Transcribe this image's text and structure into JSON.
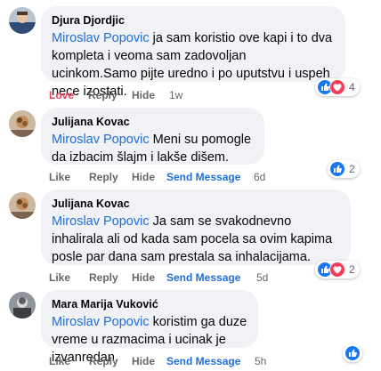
{
  "comments": [
    {
      "author": "Djura Djordjic",
      "mention": "Miroslav Popovic",
      "text": " ja sam koristio ove kapi i to dva kompleta i veoma sam zadovoljan ucinkom.Samo pijte uredno i po uputstvu i uspeh nece izostati.",
      "actions": {
        "react": "Love",
        "reply": "Reply",
        "hide": "Hide",
        "time": "1w"
      },
      "reaction_count": "4",
      "reactions": [
        "like-icon",
        "love-icon"
      ]
    },
    {
      "author": "Julijana Kovac",
      "mention": "Miroslav Popovic",
      "text": " Meni su pomogle da izbacim šlajm i lakše dišem.",
      "actions": {
        "react": "Like",
        "reply": "Reply",
        "hide": "Hide",
        "send": "Send Message",
        "time": "6d"
      },
      "reaction_count": "2",
      "reactions": [
        "like-icon"
      ]
    },
    {
      "author": "Julijana Kovac",
      "mention": "Miroslav Popovic",
      "text": " Ja sam se svakodnevno inhalirala ali od kada sam pocela sa ovim kapima posle par dana sam prestala sa inhalacijama.",
      "actions": {
        "react": "Like",
        "reply": "Reply",
        "hide": "Hide",
        "send": "Send Message",
        "time": "5d"
      },
      "reaction_count": "2",
      "reactions": [
        "like-icon",
        "love-icon"
      ]
    },
    {
      "author": "Mara Marija Vuković",
      "mention": "Miroslav Popovic",
      "text": " koristim ga duze vreme u razmacima i ucinak je izvanredan.",
      "actions": {
        "react": "Like",
        "reply": "Reply",
        "hide": "Hide",
        "send": "Send Message",
        "time": "5h"
      },
      "reaction_count": "",
      "reactions": [
        "like-icon"
      ]
    }
  ],
  "colors": {
    "bubble_bg": "#f0f2f5",
    "mention": "#216fdb",
    "love": "#f33e58",
    "like": "#1877f2",
    "meta": "#65676b"
  }
}
